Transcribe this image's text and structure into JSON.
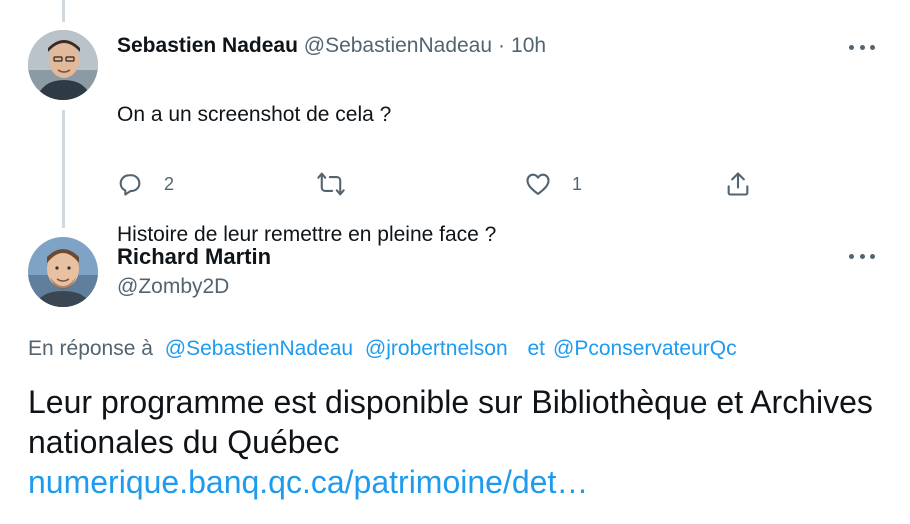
{
  "reply": {
    "author_name": "Sebastien Nadeau",
    "author_handle": "@SebastienNadeau",
    "separator": "·",
    "time": "10h",
    "text_line1": "On a un screenshot de cela ?",
    "text_line2": "Histoire de leur remettre en pleine face ?",
    "reply_count": "2",
    "like_count": "1",
    "icons": [
      "reply-icon",
      "retweet-icon",
      "like-icon",
      "share-icon",
      "more-icon"
    ]
  },
  "main_tweet": {
    "author_name": "Richard Martin",
    "author_handle": "@Zomby2D",
    "reply_to_prefix": "En réponse à",
    "mentions": [
      "@SebastienNadeau",
      "@jrobertnelson",
      "@PconservateurQc"
    ],
    "mention_conjunction": "et",
    "text": "Leur programme est disponible sur Bibliothèque et Archives nationales du Québec",
    "link": "numerique.banq.qc.ca/patrimoine/det…"
  },
  "colors": {
    "link": "#1d9bf0",
    "secondary_text": "#536471",
    "thread_line": "#cfd9de"
  }
}
